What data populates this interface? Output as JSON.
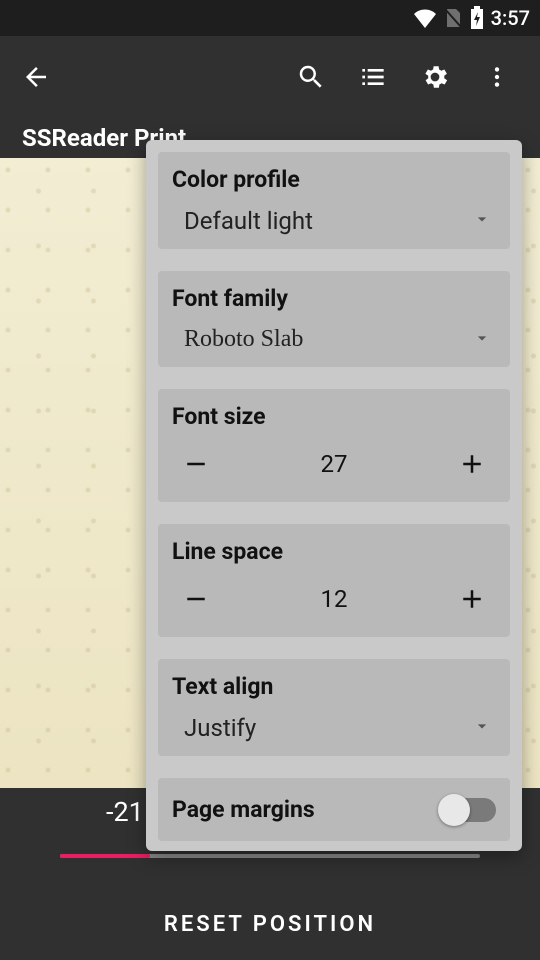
{
  "status": {
    "time": "3:57"
  },
  "app": {
    "title": "SSReader Print"
  },
  "progress": {
    "position_label": "-21"
  },
  "reset_button": "RESET POSITION",
  "settings": {
    "color_profile": {
      "label": "Color profile",
      "value": "Default light"
    },
    "font_family": {
      "label": "Font family",
      "value": "Roboto Slab"
    },
    "font_size": {
      "label": "Font size",
      "value": "27"
    },
    "line_space": {
      "label": "Line space",
      "value": "12"
    },
    "text_align": {
      "label": "Text align",
      "value": "Justify"
    },
    "page_margins": {
      "label": "Page margins",
      "on": false
    }
  }
}
